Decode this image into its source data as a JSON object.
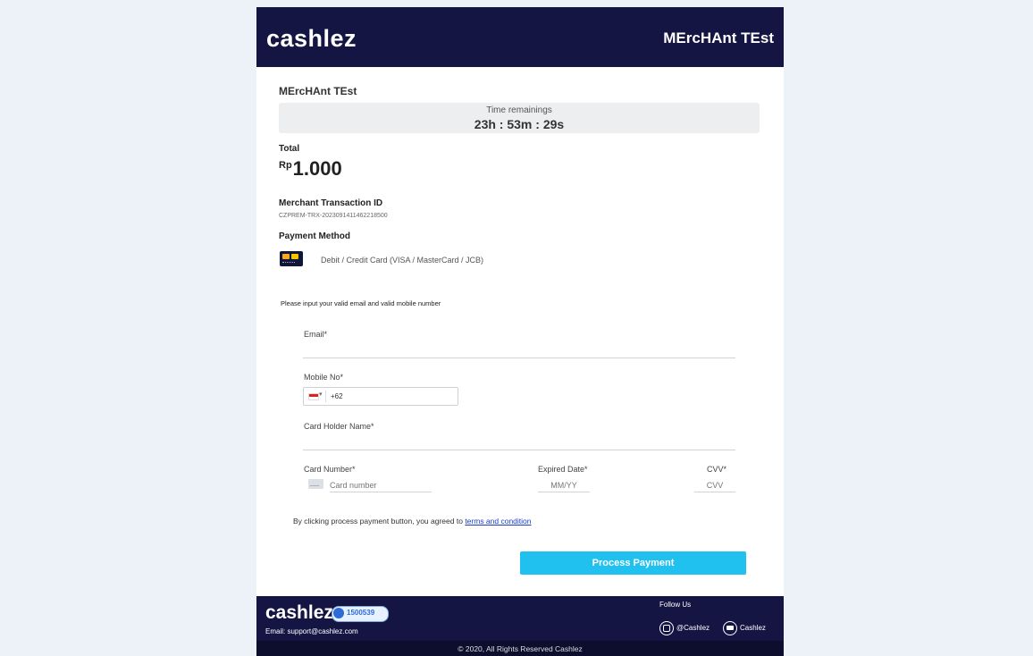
{
  "header": {
    "brand": "cashlez",
    "merchant": "MErcHAnt TEst"
  },
  "merchant_name": "MErcHAnt TEst",
  "timer": {
    "label": "Time remainings",
    "value": "23h : 53m : 29s"
  },
  "total": {
    "label": "Total",
    "currency": "Rp",
    "amount": "1.000"
  },
  "transaction": {
    "label": "Merchant Transaction ID",
    "value": "CZPREM-TRX-20230914114622185​00"
  },
  "payment_method": {
    "label": "Payment Method",
    "icon": "credit-card-icon",
    "text": "Debit / Credit Card (VISA / MasterCard / JCB)"
  },
  "form": {
    "instruction": "Please input your valid email and valid mobile number",
    "email_label": "Email*",
    "email_value": "",
    "mobile_label": "Mobile No*",
    "mobile_code": "+62",
    "mobile_value": "",
    "card_holder_label": "Card Holder Name*",
    "card_holder_value": "",
    "card_number_label": "Card Number*",
    "card_number_placeholder": "Card number",
    "expired_label": "Expired Date*",
    "expired_placeholder": "MM/YY",
    "cvv_label": "CVV*",
    "cvv_placeholder": "CVV"
  },
  "terms": {
    "prefix": "By clicking process payment button, you agreed to ",
    "link": "terms and condition"
  },
  "button": {
    "label": "Process Payment",
    "color": "#21c1ef"
  },
  "footer": {
    "brand": "cashlez",
    "badge": "1500539",
    "email": "Email: support@cashlez.com",
    "follow": "Follow Us",
    "instagram": "@Cashlez",
    "youtube": "Cashlez",
    "copyright": "© 2020, All Rights Reserved Cashlez"
  },
  "colors": {
    "header_bg": "#151544",
    "page_bg": "#edf2f9",
    "accent": "#21c1ef"
  }
}
